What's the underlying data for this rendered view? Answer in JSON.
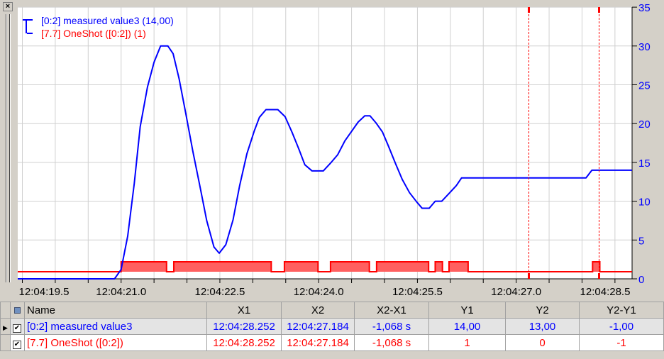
{
  "toolbar": {
    "close_label": "×"
  },
  "legend": {
    "series1": "[0:2] measured value3 (14,00)",
    "series2": "[7.7] OneShot ([0:2]) (1)"
  },
  "colors": {
    "series1": "#0000ff",
    "series2": "#ff0000",
    "pulse_fill": "#ff6060",
    "grid": "#d0d0d0"
  },
  "chart_data": {
    "type": "line",
    "x_range": [
      19.43,
      28.76
    ],
    "x_ticks": [
      19.5,
      21.0,
      22.5,
      24.0,
      25.5,
      27.0,
      28.5
    ],
    "x_tick_labels": [
      "12:04:19.5",
      "12:04:21.0",
      "12:04:22.5",
      "12:04:24.0",
      "12:04:25.5",
      "12:04:27.0",
      "12:04:28.5"
    ],
    "x_tick_prefix": "12:04:",
    "y_range": [
      0,
      35
    ],
    "y_ticks": [
      "35",
      "30",
      "25",
      "20",
      "15",
      "10",
      "5",
      "0"
    ],
    "grid": true,
    "cursors": [
      27.184,
      28.252
    ],
    "series": [
      {
        "name": "[0:2] measured value3",
        "points": [
          [
            19.43,
            0
          ],
          [
            20.9,
            0
          ],
          [
            21.0,
            1.2
          ],
          [
            21.1,
            5.5
          ],
          [
            21.2,
            12.3
          ],
          [
            21.29,
            19.6
          ],
          [
            21.4,
            24.7
          ],
          [
            21.5,
            27.9
          ],
          [
            21.6,
            30
          ],
          [
            21.71,
            30
          ],
          [
            21.79,
            29
          ],
          [
            21.88,
            25.8
          ],
          [
            21.98,
            21.4
          ],
          [
            22.09,
            16.4
          ],
          [
            22.2,
            11.8
          ],
          [
            22.3,
            7.5
          ],
          [
            22.41,
            4.1
          ],
          [
            22.49,
            3.3
          ],
          [
            22.59,
            4.4
          ],
          [
            22.7,
            7.6
          ],
          [
            22.8,
            12
          ],
          [
            22.91,
            16.1
          ],
          [
            23.02,
            19
          ],
          [
            23.1,
            20.8
          ],
          [
            23.2,
            21.8
          ],
          [
            23.38,
            21.8
          ],
          [
            23.49,
            20.9
          ],
          [
            23.6,
            18.8
          ],
          [
            23.7,
            16.7
          ],
          [
            23.79,
            14.7
          ],
          [
            23.9,
            13.9
          ],
          [
            24.07,
            13.9
          ],
          [
            24.18,
            14.9
          ],
          [
            24.29,
            16
          ],
          [
            24.4,
            17.8
          ],
          [
            24.5,
            19
          ],
          [
            24.6,
            20.2
          ],
          [
            24.7,
            21
          ],
          [
            24.78,
            21
          ],
          [
            24.87,
            20.1
          ],
          [
            24.97,
            18.9
          ],
          [
            25.06,
            17.1
          ],
          [
            25.17,
            14.8
          ],
          [
            25.27,
            12.8
          ],
          [
            25.38,
            11.1
          ],
          [
            25.49,
            9.9
          ],
          [
            25.57,
            9.1
          ],
          [
            25.68,
            9.1
          ],
          [
            25.77,
            10
          ],
          [
            25.87,
            10
          ],
          [
            25.98,
            11
          ],
          [
            26.09,
            12
          ],
          [
            26.17,
            13
          ],
          [
            28.06,
            13
          ],
          [
            28.15,
            14
          ],
          [
            28.76,
            14
          ]
        ]
      },
      {
        "name": "[7.7] OneShot ([0:2])",
        "type": "digital",
        "high_intervals": [
          [
            21.0,
            21.69
          ],
          [
            21.8,
            23.28
          ],
          [
            23.48,
            23.99
          ],
          [
            24.18,
            24.77
          ],
          [
            24.88,
            25.67
          ],
          [
            25.77,
            25.88
          ],
          [
            25.98,
            26.27
          ],
          [
            28.16,
            28.27
          ]
        ]
      }
    ]
  },
  "table": {
    "headers": [
      "Name",
      "X1",
      "X2",
      "X2-X1",
      "Y1",
      "Y2",
      "Y2-Y1"
    ],
    "rows": [
      {
        "name": "[0:2] measured value3",
        "x1": "12:04:28.252",
        "x2": "12:04:27.184",
        "dx": "-1,068 s",
        "y1": "14,00",
        "y2": "13,00",
        "dy": "-1,00",
        "checked": "✔"
      },
      {
        "name": "[7.7] OneShot ([0:2])",
        "x1": "12:04:28.252",
        "x2": "12:04:27.184",
        "dx": "-1,068 s",
        "y1": "1",
        "y2": "0",
        "dy": "-1",
        "checked": "✔"
      }
    ]
  }
}
